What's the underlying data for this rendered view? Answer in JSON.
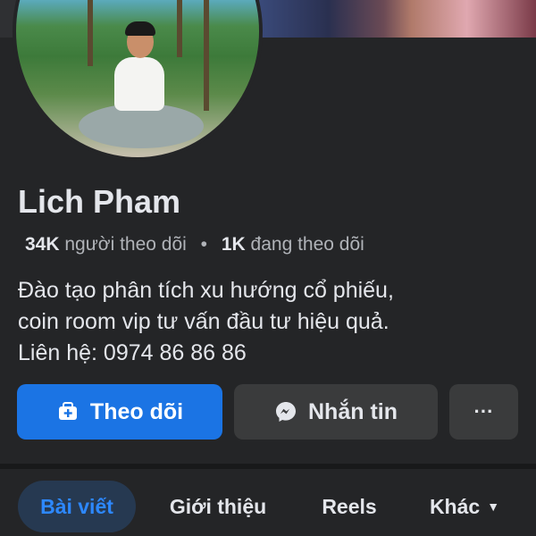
{
  "profile": {
    "name": "Lich Pham",
    "followers_count": "34K",
    "followers_label": "người theo dõi",
    "separator": "•",
    "following_count": "1K",
    "following_label": "đang theo dõi",
    "bio_lines": [
      "Đào tạo phân tích xu hướng cổ phiếu,",
      "coin room vip tư vấn đầu tư hiệu quả.",
      "Liên hệ: 0974 86 86 86"
    ]
  },
  "actions": {
    "follow_label": "Theo dõi",
    "follow_icon": "follow-icon",
    "message_label": "Nhắn tin",
    "message_icon": "messenger-icon",
    "more_label": "···"
  },
  "tabs": [
    {
      "label": "Bài viết",
      "active": true
    },
    {
      "label": "Giới thiệu",
      "active": false
    },
    {
      "label": "Reels",
      "active": false
    },
    {
      "label": "Khác",
      "active": false,
      "dropdown": true
    }
  ],
  "colors": {
    "accent": "#1b74e4",
    "background": "#242527",
    "button_secondary": "#3a3b3c",
    "active_tab_bg": "#263951",
    "active_tab_text": "#2d88ff"
  }
}
